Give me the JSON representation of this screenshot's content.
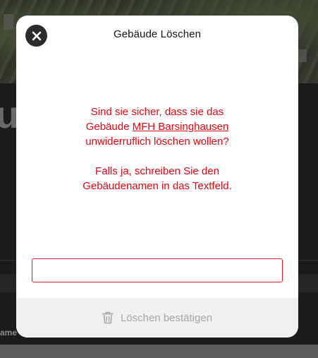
{
  "background": {
    "heading_fragment": "u",
    "row_label_fragment": "ame"
  },
  "dialog": {
    "title": "Gebäude Löschen",
    "close_icon": "close-icon",
    "message": {
      "line1": "Sind sie sicher, dass sie das",
      "line2_prefix": "Gebäude ",
      "building_name": "MFH Barsinghausen",
      "line3": "unwiderruflich löschen wollen?",
      "line4": "Falls ja, schreiben Sie den",
      "line5": "Gebäudenamen in das Textfeld."
    },
    "input": {
      "value": "",
      "placeholder": ""
    },
    "confirm_button": {
      "label": "Löschen bestätigen",
      "icon": "trash-icon",
      "enabled": false
    }
  },
  "colors": {
    "warning_text": "#e30613",
    "input_border": "#d0222c",
    "disabled_text": "#a8a8a8",
    "footer_bg": "#f0f0f0"
  }
}
